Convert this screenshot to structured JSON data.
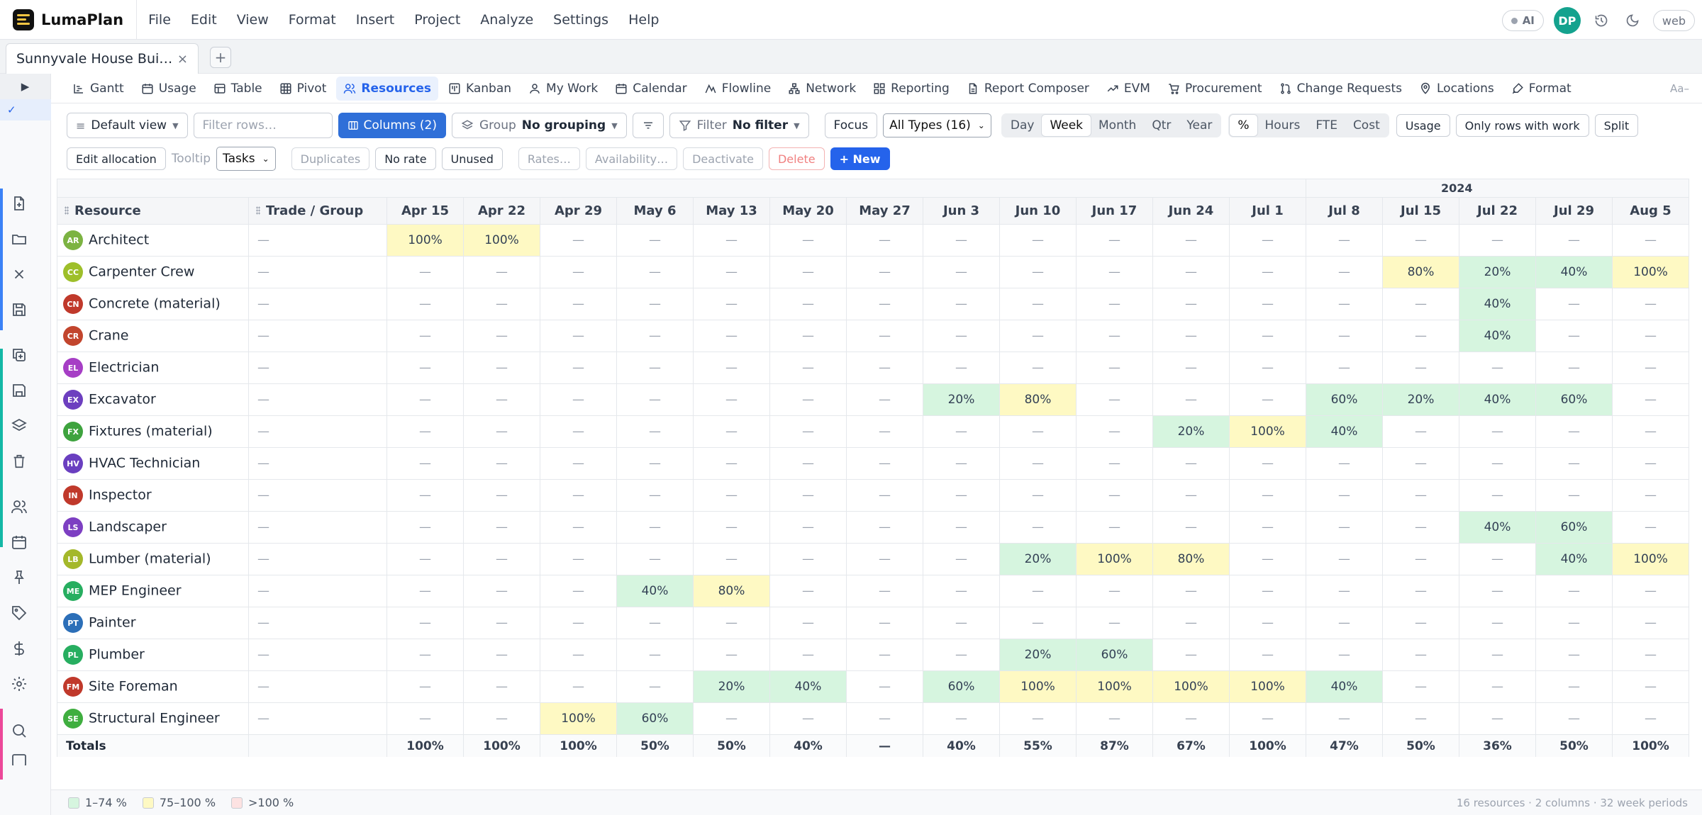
{
  "app": {
    "name": "LumaPlan"
  },
  "menu": [
    "File",
    "Edit",
    "View",
    "Format",
    "Insert",
    "Project",
    "Analyze",
    "Settings",
    "Help"
  ],
  "topright": {
    "ai_label": "AI",
    "user_initials": "DP",
    "mode_label": "web",
    "user_color": "#14a28e"
  },
  "doc_tab": {
    "title": "Sunnyvale House Bui…",
    "close": "×",
    "new_tab": "+"
  },
  "rail": {
    "collapse_glyph": "▶",
    "check_glyph": "✓",
    "accent_colors": [
      "#3b82f6",
      "#14b8a6",
      "#ec4899"
    ]
  },
  "view_tabs": {
    "items": [
      {
        "label": "Gantt",
        "icon": "gantt-icon"
      },
      {
        "label": "Usage",
        "icon": "usage-icon"
      },
      {
        "label": "Table",
        "icon": "table-icon"
      },
      {
        "label": "Pivot",
        "icon": "pivot-icon"
      },
      {
        "label": "Resources",
        "icon": "resources-icon",
        "active": true
      },
      {
        "label": "Kanban",
        "icon": "kanban-icon"
      },
      {
        "label": "My Work",
        "icon": "my-work-icon"
      },
      {
        "label": "Calendar",
        "icon": "calendar-icon"
      },
      {
        "label": "Flowline",
        "icon": "flowline-icon"
      },
      {
        "label": "Network",
        "icon": "network-icon"
      },
      {
        "label": "Reporting",
        "icon": "reporting-icon"
      },
      {
        "label": "Report Composer",
        "icon": "report-composer-icon"
      },
      {
        "label": "EVM",
        "icon": "evm-icon"
      },
      {
        "label": "Procurement",
        "icon": "procurement-icon"
      },
      {
        "label": "Change Requests",
        "icon": "change-requests-icon"
      },
      {
        "label": "Locations",
        "icon": "locations-icon"
      },
      {
        "label": "Format",
        "icon": "format-icon"
      }
    ],
    "font_size_label": "Aa–"
  },
  "toolbar": {
    "view_select": "Default view",
    "filter_placeholder": "Filter rows…",
    "columns_label": "Columns (2)",
    "group_label": "Group",
    "group_value": "No grouping",
    "filter_label": "Filter",
    "filter_value": "No filter",
    "focus_label": "Focus",
    "types_select": "All Types (16)",
    "period_options": [
      "Day",
      "Week",
      "Month",
      "Qtr",
      "Year"
    ],
    "period_selected": "Week",
    "unit_options": [
      "%",
      "Hours",
      "FTE",
      "Cost"
    ],
    "unit_selected": "%",
    "usage_label": "Usage",
    "only_rows_label": "Only rows with work",
    "split_label": "Split",
    "edit_allocation_label": "Edit allocation",
    "tooltip_label": "Tooltip",
    "tooltip_select": "Tasks",
    "duplicates_label": "Duplicates",
    "no_rate_label": "No rate",
    "unused_label": "Unused",
    "rates_label": "Rates…",
    "availability_label": "Availability…",
    "deactivate_label": "Deactivate",
    "delete_label": "Delete",
    "new_label": "+ New"
  },
  "grid": {
    "year_label": "2024",
    "col_resource": "Resource",
    "col_trade": "Trade / Group",
    "weeks": [
      "Apr 15",
      "Apr 22",
      "Apr 29",
      "May 6",
      "May 13",
      "May 20",
      "May 27",
      "Jun 3",
      "Jun 10",
      "Jun 17",
      "Jun 24",
      "Jul 1",
      "Jul 8",
      "Jul 15",
      "Jul 22",
      "Jul 29",
      "Aug 5"
    ],
    "rows": [
      {
        "initials": "AR",
        "name": "Architect",
        "color": "#7cb342",
        "trade": "—",
        "cells": [
          "100%",
          "100%",
          "—",
          "—",
          "—",
          "—",
          "—",
          "—",
          "—",
          "—",
          "—",
          "—",
          "—",
          "—",
          "—",
          "—",
          "—"
        ]
      },
      {
        "initials": "CC",
        "name": "Carpenter Crew",
        "color": "#9ebf2a",
        "trade": "—",
        "cells": [
          "—",
          "—",
          "—",
          "—",
          "—",
          "—",
          "—",
          "—",
          "—",
          "—",
          "—",
          "—",
          "—",
          "80%",
          "20%",
          "40%",
          "100%"
        ]
      },
      {
        "initials": "CN",
        "name": "Concrete (material)",
        "color": "#c0392b",
        "trade": "—",
        "cells": [
          "—",
          "—",
          "—",
          "—",
          "—",
          "—",
          "—",
          "—",
          "—",
          "—",
          "—",
          "—",
          "—",
          "—",
          "40%",
          "—",
          "—"
        ]
      },
      {
        "initials": "CR",
        "name": "Crane",
        "color": "#c2452d",
        "trade": "—",
        "cells": [
          "—",
          "—",
          "—",
          "—",
          "—",
          "—",
          "—",
          "—",
          "—",
          "—",
          "—",
          "—",
          "—",
          "—",
          "40%",
          "—",
          "—"
        ]
      },
      {
        "initials": "EL",
        "name": "Electrician",
        "color": "#a63ec5",
        "trade": "—",
        "cells": [
          "—",
          "—",
          "—",
          "—",
          "—",
          "—",
          "—",
          "—",
          "—",
          "—",
          "—",
          "—",
          "—",
          "—",
          "—",
          "—",
          "—"
        ]
      },
      {
        "initials": "EX",
        "name": "Excavator",
        "color": "#6d3fbf",
        "trade": "—",
        "cells": [
          "—",
          "—",
          "—",
          "—",
          "—",
          "—",
          "—",
          "20%",
          "80%",
          "—",
          "—",
          "—",
          "60%",
          "20%",
          "40%",
          "60%",
          "—"
        ]
      },
      {
        "initials": "FX",
        "name": "Fixtures (material)",
        "color": "#3ea33e",
        "trade": "—",
        "cells": [
          "—",
          "—",
          "—",
          "—",
          "—",
          "—",
          "—",
          "—",
          "—",
          "—",
          "20%",
          "100%",
          "40%",
          "—",
          "—",
          "—",
          "—"
        ]
      },
      {
        "initials": "HV",
        "name": "HVAC Technician",
        "color": "#6a3fc0",
        "trade": "—",
        "cells": [
          "—",
          "—",
          "—",
          "—",
          "—",
          "—",
          "—",
          "—",
          "—",
          "—",
          "—",
          "—",
          "—",
          "—",
          "—",
          "—",
          "—"
        ]
      },
      {
        "initials": "IN",
        "name": "Inspector",
        "color": "#c0392b",
        "trade": "—",
        "cells": [
          "—",
          "—",
          "—",
          "—",
          "—",
          "—",
          "—",
          "—",
          "—",
          "—",
          "—",
          "—",
          "—",
          "—",
          "—",
          "—",
          "—"
        ]
      },
      {
        "initials": "LS",
        "name": "Landscaper",
        "color": "#7d3fc2",
        "trade": "—",
        "cells": [
          "—",
          "—",
          "—",
          "—",
          "—",
          "—",
          "—",
          "—",
          "—",
          "—",
          "—",
          "—",
          "—",
          "—",
          "40%",
          "60%",
          "—"
        ]
      },
      {
        "initials": "LB",
        "name": "Lumber (material)",
        "color": "#a4b82a",
        "trade": "—",
        "cells": [
          "—",
          "—",
          "—",
          "—",
          "—",
          "—",
          "—",
          "—",
          "20%",
          "100%",
          "80%",
          "—",
          "—",
          "—",
          "—",
          "40%",
          "100%"
        ]
      },
      {
        "initials": "ME",
        "name": "MEP Engineer",
        "color": "#27ae60",
        "trade": "—",
        "cells": [
          "—",
          "—",
          "—",
          "40%",
          "80%",
          "—",
          "—",
          "—",
          "—",
          "—",
          "—",
          "—",
          "—",
          "—",
          "—",
          "—",
          "—"
        ]
      },
      {
        "initials": "PT",
        "name": "Painter",
        "color": "#2c6fb8",
        "trade": "—",
        "cells": [
          "—",
          "—",
          "—",
          "—",
          "—",
          "—",
          "—",
          "—",
          "—",
          "—",
          "—",
          "—",
          "—",
          "—",
          "—",
          "—",
          "—"
        ]
      },
      {
        "initials": "PL",
        "name": "Plumber",
        "color": "#27ae60",
        "trade": "—",
        "cells": [
          "—",
          "—",
          "—",
          "—",
          "—",
          "—",
          "—",
          "—",
          "20%",
          "60%",
          "—",
          "—",
          "—",
          "—",
          "—",
          "—",
          "—"
        ]
      },
      {
        "initials": "FM",
        "name": "Site Foreman",
        "color": "#c0392b",
        "trade": "—",
        "cells": [
          "—",
          "—",
          "—",
          "—",
          "20%",
          "40%",
          "—",
          "60%",
          "100%",
          "100%",
          "100%",
          "100%",
          "40%",
          "—",
          "—",
          "—",
          "—"
        ]
      },
      {
        "initials": "SE",
        "name": "Structural Engineer",
        "color": "#3fae3f",
        "trade": "—",
        "cells": [
          "—",
          "—",
          "100%",
          "60%",
          "—",
          "—",
          "—",
          "—",
          "—",
          "—",
          "—",
          "—",
          "—",
          "—",
          "—",
          "—",
          "—"
        ]
      }
    ],
    "totals_label": "Totals",
    "totals": [
      "100%",
      "100%",
      "100%",
      "50%",
      "50%",
      "40%",
      "—",
      "40%",
      "55%",
      "87%",
      "67%",
      "100%",
      "47%",
      "50%",
      "36%",
      "50%",
      "100%"
    ]
  },
  "legend": [
    {
      "label": "1–74 %",
      "color": "#d6f5df"
    },
    {
      "label": "75–100 %",
      "color": "#fef9c3"
    },
    {
      "label": ">100 %",
      "color": "#fde2e2"
    }
  ],
  "status_text": "16 resources · 2 columns · 32 week periods"
}
